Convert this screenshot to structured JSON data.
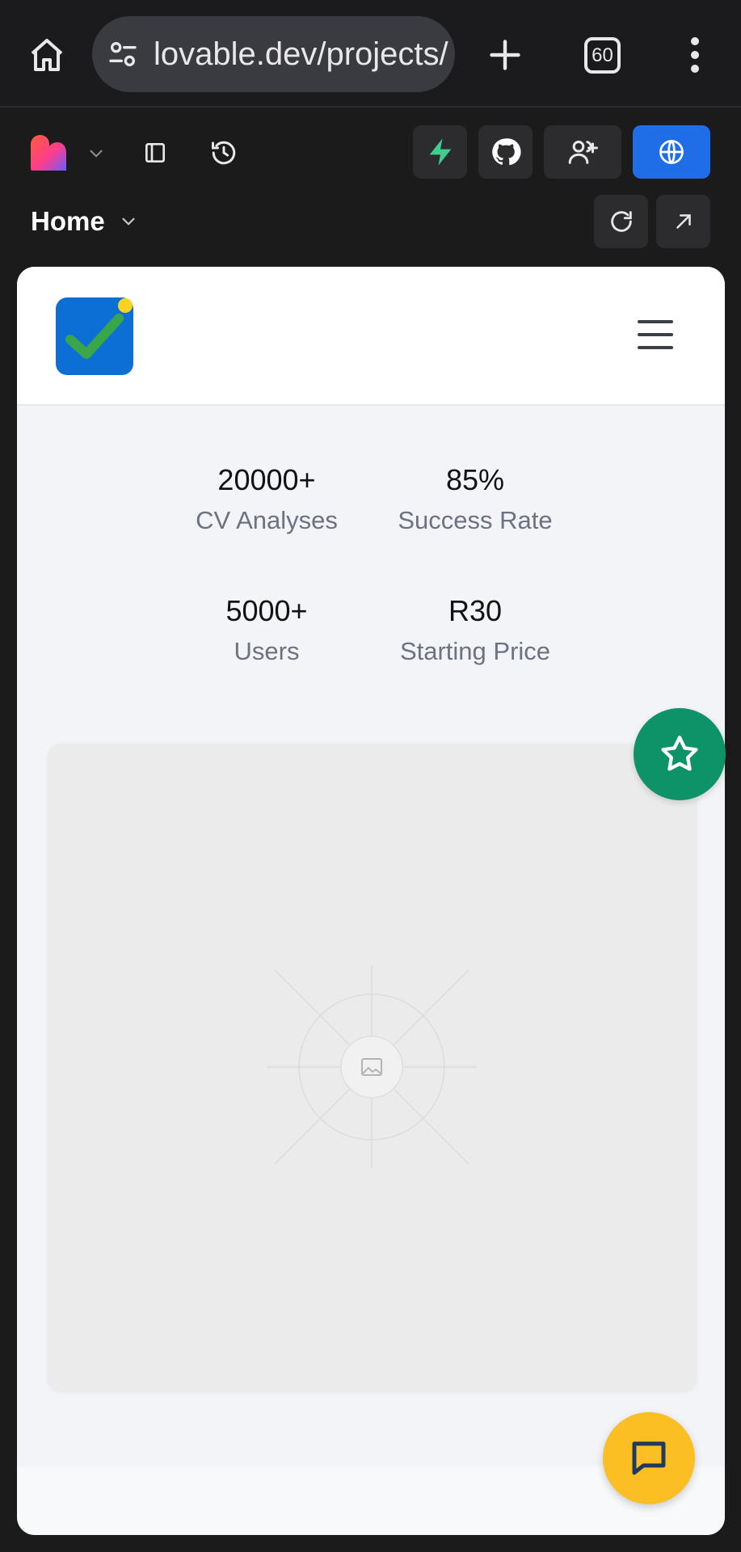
{
  "browser": {
    "url": "lovable.dev/projects/",
    "tab_count": "60",
    "icons": [
      "home-icon",
      "site-settings-icon",
      "plus-icon",
      "tabs-icon",
      "more-vert-icon"
    ]
  },
  "app_bar": {
    "page_label": "Home",
    "icons": [
      "lovable-logo-icon",
      "chevron-down-icon",
      "sidebar-icon",
      "history-icon",
      "supabase-icon",
      "github-icon",
      "invite-users-icon",
      "globe-icon",
      "refresh-icon",
      "open-external-icon"
    ],
    "colors": {
      "publish": "#1f6ee8",
      "supabase": "#3ecf8e"
    }
  },
  "site": {
    "stats": [
      {
        "value": "20000+",
        "label": "CV Analyses"
      },
      {
        "value": "85%",
        "label": "Success Rate"
      },
      {
        "value": "5000+",
        "label": "Users"
      },
      {
        "value": "R30",
        "label": "Starting Price"
      }
    ],
    "colors": {
      "logo_bg": "#0b6fd6",
      "check": "#3aa64a",
      "fav_fab": "#0e9268",
      "chat_fab": "#fbbf24"
    },
    "icons": [
      "site-logo-icon",
      "hamburger-icon",
      "image-placeholder-icon",
      "star-icon",
      "chat-icon"
    ]
  }
}
